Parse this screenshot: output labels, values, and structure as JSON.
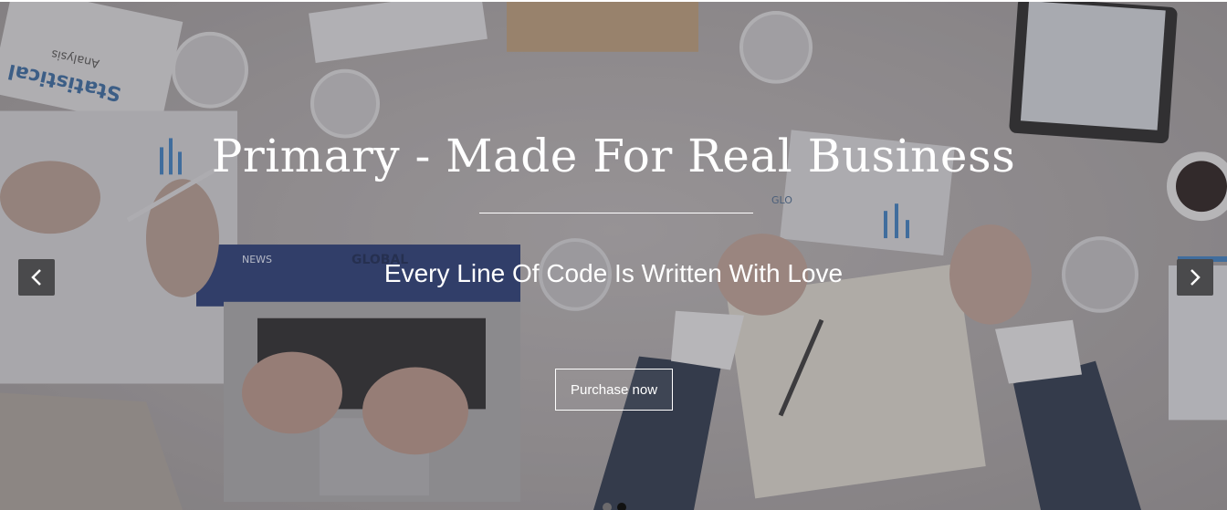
{
  "slide": {
    "title": "Primary - Made For Real Business",
    "subtitle": "Every Line Of Code Is Written With Love",
    "cta_label": "Purchase now"
  },
  "controls": {
    "prev_icon": "chevron-left-icon",
    "next_icon": "chevron-right-icon",
    "slide_count": 2,
    "active_slide": 2
  },
  "background_image": {
    "printed_texts": [
      "Statistical",
      "Analysis",
      "NEWS",
      "GLOBAL",
      "GLO"
    ]
  },
  "colors": {
    "text": "#ffffff",
    "arrow_bg": "#4a4a4c",
    "dot_inactive": "#6c6a6c",
    "dot_active": "#111111"
  }
}
